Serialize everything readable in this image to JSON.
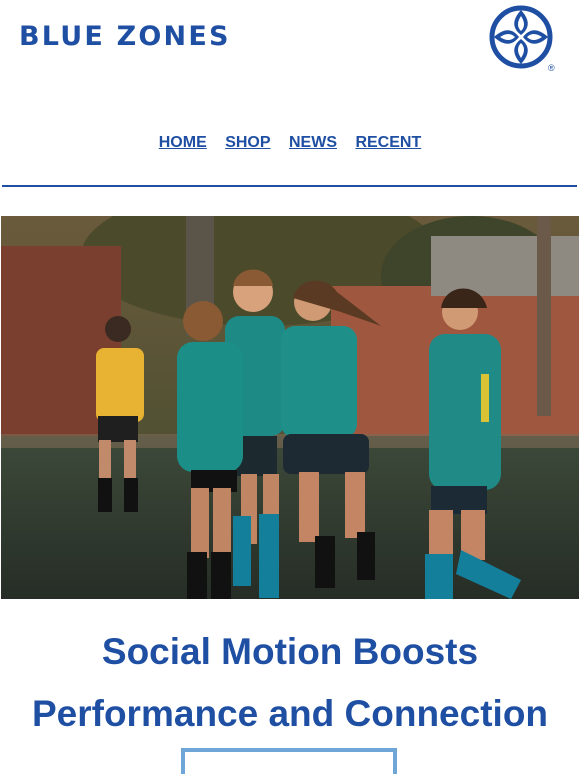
{
  "colors": {
    "brand": "#1f4fa3",
    "accent": "#6ea6d8"
  },
  "header": {
    "brand_name": "BLUE ZONES",
    "logo_icon": "blue-zones-emblem-icon",
    "logo_mark": "®"
  },
  "nav": {
    "items": [
      {
        "label": "HOME"
      },
      {
        "label": "SHOP"
      },
      {
        "label": "NEWS"
      },
      {
        "label": "RECENT"
      }
    ]
  },
  "hero": {
    "image_icon": "soccer-team-celebration-photo"
  },
  "article": {
    "headline_line1": "Social Motion Boosts",
    "headline_line2": "Performance and Connection"
  }
}
